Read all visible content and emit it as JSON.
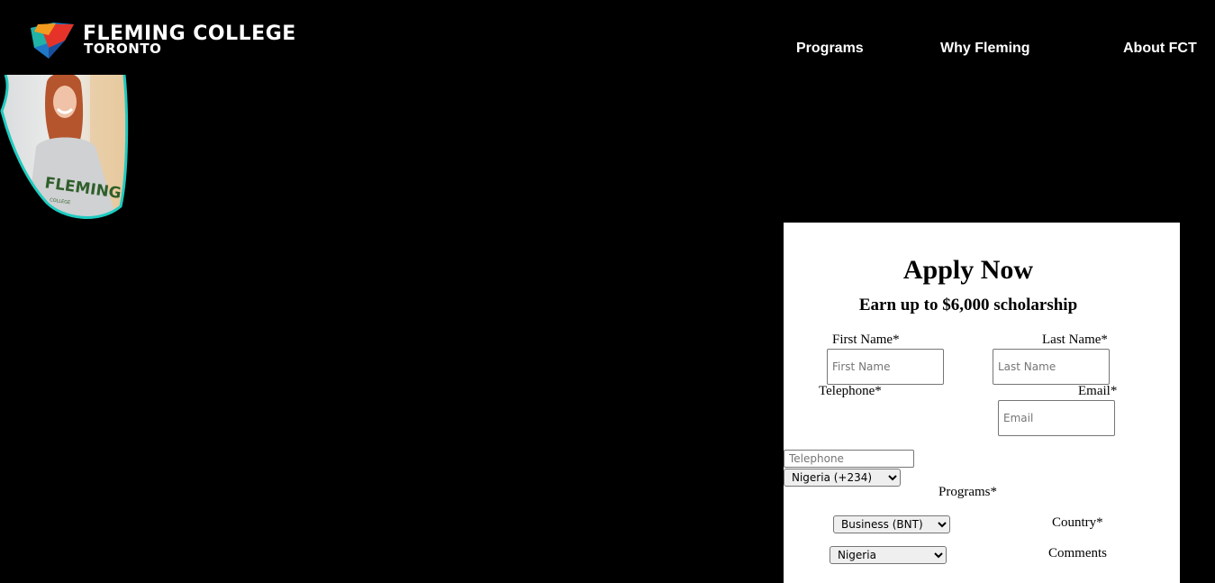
{
  "header": {
    "logo": {
      "title": "FLEMING COLLEGE",
      "subtitle": "TORONTO"
    },
    "nav": [
      {
        "label": "Programs"
      },
      {
        "label": "Why Fleming"
      },
      {
        "label": "About FCT"
      }
    ]
  },
  "form": {
    "title": "Apply Now",
    "subtitle": "Earn up to $6,000 scholarship",
    "first_name": {
      "label": "First Name*",
      "placeholder": "First Name"
    },
    "last_name": {
      "label": "Last Name*",
      "placeholder": "Last Name"
    },
    "telephone": {
      "label": "Telephone*",
      "placeholder": "Telephone",
      "country_code": "Nigeria (+234)"
    },
    "email": {
      "label": "Email*",
      "placeholder": "Email"
    },
    "programs": {
      "label": "Programs*",
      "selected": "Business (BNT)"
    },
    "country": {
      "label": "Country*",
      "selected": "Nigeria"
    },
    "comments": {
      "label": "Comments"
    }
  },
  "colors": {
    "background": "#000000",
    "card": "#ffffff",
    "hero_border": "#1ecbc0",
    "logo_red": "#e63329",
    "logo_orange": "#f39a1f",
    "logo_blue": "#1f77c5",
    "logo_teal": "#20b3a6"
  }
}
